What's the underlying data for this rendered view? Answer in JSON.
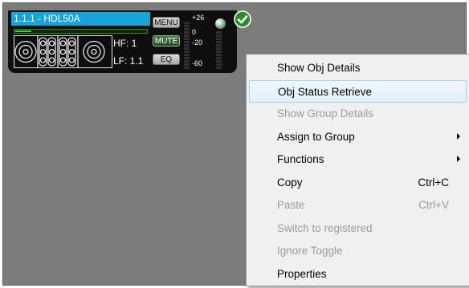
{
  "device": {
    "title": "1.1.1 - HDL50A",
    "signal_level": 0.12,
    "hf_label": "HF: 1",
    "lf_label": "LF: 1.1",
    "menu_label": "MENU",
    "mute_label": "MUTE",
    "eq_label": "EQ",
    "meter_scale": [
      "+26",
      "0",
      "-20",
      "-60"
    ],
    "status_icon": "check-circle-icon",
    "status_color": "#2e8b2e",
    "led_icon": "status-led-icon"
  },
  "context_menu": {
    "items": [
      {
        "label": "Show Obj Details",
        "shortcut": "",
        "enabled": true,
        "submenu": false,
        "highlighted": false
      },
      {
        "label": "Obj Status Retrieve",
        "shortcut": "",
        "enabled": true,
        "submenu": false,
        "highlighted": true
      },
      {
        "label": "Show Group Details",
        "shortcut": "",
        "enabled": false,
        "submenu": false,
        "highlighted": false
      },
      {
        "label": "Assign to Group",
        "shortcut": "",
        "enabled": true,
        "submenu": true,
        "highlighted": false
      },
      {
        "label": "Functions",
        "shortcut": "",
        "enabled": true,
        "submenu": true,
        "highlighted": false
      },
      {
        "label": "Copy",
        "shortcut": "Ctrl+C",
        "enabled": true,
        "submenu": false,
        "highlighted": false
      },
      {
        "label": "Paste",
        "shortcut": "Ctrl+V",
        "enabled": false,
        "submenu": false,
        "highlighted": false
      },
      {
        "label": "Switch to registered",
        "shortcut": "",
        "enabled": false,
        "submenu": false,
        "highlighted": false
      },
      {
        "label": "Ignore Toggle",
        "shortcut": "",
        "enabled": false,
        "submenu": false,
        "highlighted": false
      },
      {
        "label": "Properties",
        "shortcut": "",
        "enabled": true,
        "submenu": false,
        "highlighted": false
      }
    ]
  },
  "colors": {
    "canvas_bg": "#7c7c7c",
    "title_bar": "#18a4d6",
    "menu_hover_border": "#a8d0f3"
  }
}
